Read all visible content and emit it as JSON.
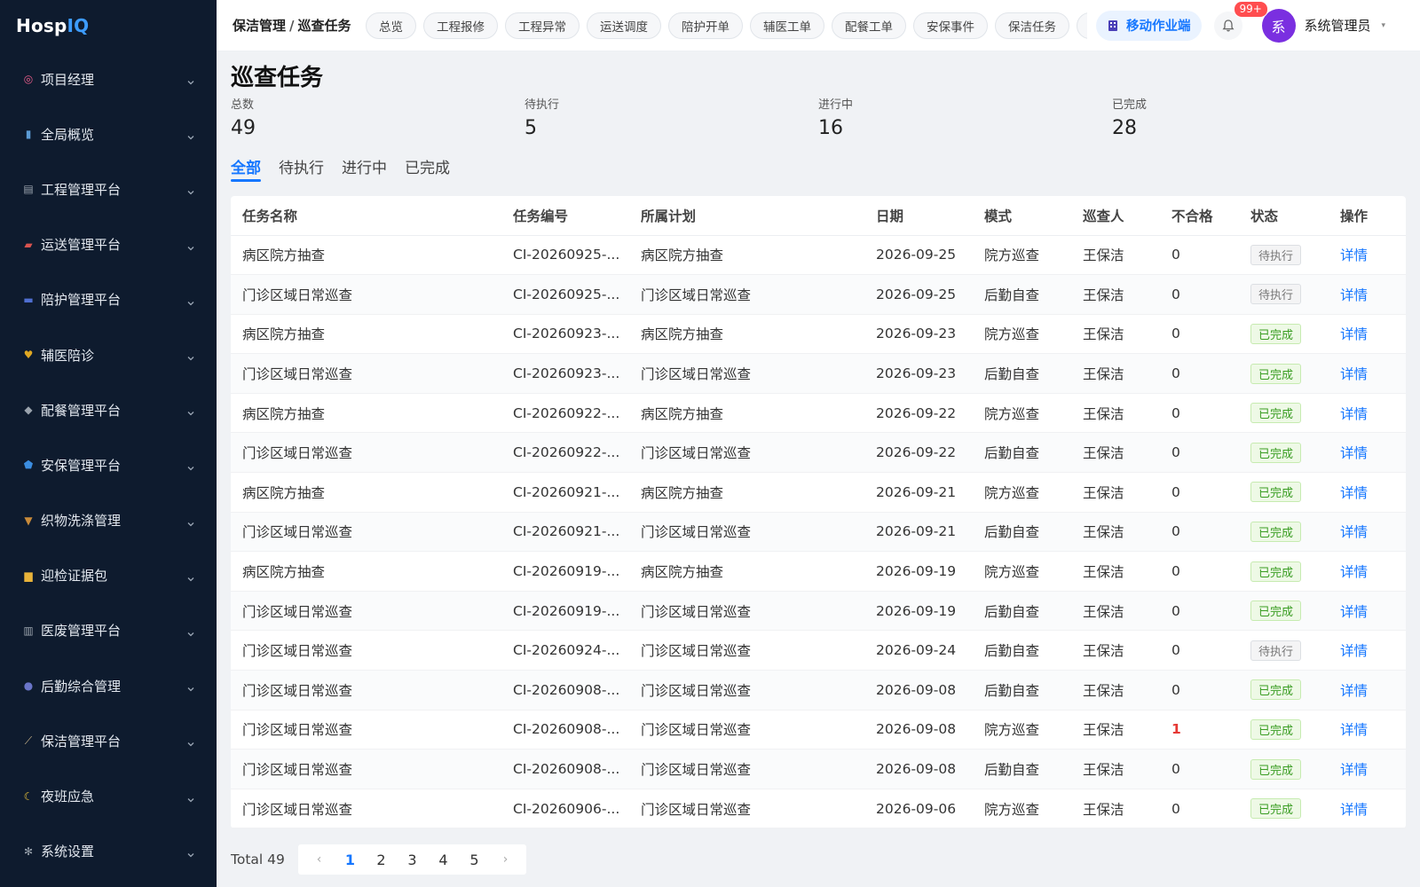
{
  "app": {
    "logo_main": "Hosp",
    "logo_accent": "IQ"
  },
  "sidebar": {
    "items": [
      {
        "label": "项目经理",
        "icon": "target-icon",
        "color": "#e85d8a"
      },
      {
        "label": "全局概览",
        "icon": "chart-icon",
        "color": "#5b9bd5"
      },
      {
        "label": "工程管理平台",
        "icon": "building-icon",
        "color": "#9aa3ad"
      },
      {
        "label": "运送管理平台",
        "icon": "truck-icon",
        "color": "#d9534f"
      },
      {
        "label": "陪护管理平台",
        "icon": "bed-icon",
        "color": "#4f6fd1"
      },
      {
        "label": "辅医陪诊",
        "icon": "heart-icon",
        "color": "#e0a823"
      },
      {
        "label": "配餐管理平台",
        "icon": "food-icon",
        "color": "#9aa3ad"
      },
      {
        "label": "安保管理平台",
        "icon": "shield-icon",
        "color": "#3b8de0"
      },
      {
        "label": "织物洗涤管理",
        "icon": "basket-icon",
        "color": "#c98b3a"
      },
      {
        "label": "迎检证据包",
        "icon": "folder-icon",
        "color": "#e8b33a"
      },
      {
        "label": "医废管理平台",
        "icon": "trash-icon",
        "color": "#9aa3ad"
      },
      {
        "label": "后勤综合管理",
        "icon": "people-icon",
        "color": "#6a75c9"
      },
      {
        "label": "保洁管理平台",
        "icon": "broom-icon",
        "color": "#c9b48a"
      },
      {
        "label": "夜班应急",
        "icon": "moon-icon",
        "color": "#e8c23a"
      },
      {
        "label": "系统设置",
        "icon": "gear-icon",
        "color": "#9aa3ad"
      }
    ]
  },
  "topbar": {
    "breadcrumb_parent": "保洁管理",
    "breadcrumb_sep": "/",
    "breadcrumb_current": "巡查任务",
    "tabs": [
      "总览",
      "工程报修",
      "工程异常",
      "运送调度",
      "陪护开单",
      "辅医工单",
      "配餐工单",
      "安保事件",
      "保洁任务",
      "医"
    ],
    "mobile_label": "移动作业端",
    "notif_badge": "99+",
    "avatar_text": "系",
    "user_name": "系统管理员"
  },
  "page": {
    "title": "巡查任务",
    "stats": [
      {
        "label": "总数",
        "value": "49"
      },
      {
        "label": "待执行",
        "value": "5"
      },
      {
        "label": "进行中",
        "value": "16"
      },
      {
        "label": "已完成",
        "value": "28"
      }
    ],
    "filters": [
      "全部",
      "待执行",
      "进行中",
      "已完成"
    ],
    "active_filter": "全部"
  },
  "table": {
    "columns": [
      "任务名称",
      "任务编号",
      "所属计划",
      "日期",
      "模式",
      "巡查人",
      "不合格",
      "状态",
      "操作"
    ],
    "rows": [
      {
        "name": "病区院方抽查",
        "code": "CI-20260925-...",
        "plan": "病区院方抽查",
        "date": "2026-09-25",
        "mode": "院方巡查",
        "inspector": "王保洁",
        "fail": "0",
        "status": "待执行",
        "action": "详情"
      },
      {
        "name": "门诊区域日常巡查",
        "code": "CI-20260925-...",
        "plan": "门诊区域日常巡查",
        "date": "2026-09-25",
        "mode": "后勤自查",
        "inspector": "王保洁",
        "fail": "0",
        "status": "待执行",
        "action": "详情"
      },
      {
        "name": "病区院方抽查",
        "code": "CI-20260923-...",
        "plan": "病区院方抽查",
        "date": "2026-09-23",
        "mode": "院方巡查",
        "inspector": "王保洁",
        "fail": "0",
        "status": "已完成",
        "action": "详情"
      },
      {
        "name": "门诊区域日常巡查",
        "code": "CI-20260923-...",
        "plan": "门诊区域日常巡查",
        "date": "2026-09-23",
        "mode": "后勤自查",
        "inspector": "王保洁",
        "fail": "0",
        "status": "已完成",
        "action": "详情"
      },
      {
        "name": "病区院方抽查",
        "code": "CI-20260922-...",
        "plan": "病区院方抽查",
        "date": "2026-09-22",
        "mode": "院方巡查",
        "inspector": "王保洁",
        "fail": "0",
        "status": "已完成",
        "action": "详情"
      },
      {
        "name": "门诊区域日常巡查",
        "code": "CI-20260922-...",
        "plan": "门诊区域日常巡查",
        "date": "2026-09-22",
        "mode": "后勤自查",
        "inspector": "王保洁",
        "fail": "0",
        "status": "已完成",
        "action": "详情"
      },
      {
        "name": "病区院方抽查",
        "code": "CI-20260921-...",
        "plan": "病区院方抽查",
        "date": "2026-09-21",
        "mode": "院方巡查",
        "inspector": "王保洁",
        "fail": "0",
        "status": "已完成",
        "action": "详情"
      },
      {
        "name": "门诊区域日常巡查",
        "code": "CI-20260921-...",
        "plan": "门诊区域日常巡查",
        "date": "2026-09-21",
        "mode": "后勤自查",
        "inspector": "王保洁",
        "fail": "0",
        "status": "已完成",
        "action": "详情"
      },
      {
        "name": "病区院方抽查",
        "code": "CI-20260919-...",
        "plan": "病区院方抽查",
        "date": "2026-09-19",
        "mode": "院方巡查",
        "inspector": "王保洁",
        "fail": "0",
        "status": "已完成",
        "action": "详情"
      },
      {
        "name": "门诊区域日常巡查",
        "code": "CI-20260919-...",
        "plan": "门诊区域日常巡查",
        "date": "2026-09-19",
        "mode": "后勤自查",
        "inspector": "王保洁",
        "fail": "0",
        "status": "已完成",
        "action": "详情"
      },
      {
        "name": "门诊区域日常巡查",
        "code": "CI-20260924-...",
        "plan": "门诊区域日常巡查",
        "date": "2026-09-24",
        "mode": "后勤自查",
        "inspector": "王保洁",
        "fail": "0",
        "status": "待执行",
        "action": "详情"
      },
      {
        "name": "门诊区域日常巡查",
        "code": "CI-20260908-...",
        "plan": "门诊区域日常巡查",
        "date": "2026-09-08",
        "mode": "后勤自查",
        "inspector": "王保洁",
        "fail": "0",
        "status": "已完成",
        "action": "详情"
      },
      {
        "name": "门诊区域日常巡查",
        "code": "CI-20260908-...",
        "plan": "门诊区域日常巡查",
        "date": "2026-09-08",
        "mode": "院方巡查",
        "inspector": "王保洁",
        "fail": "1",
        "status": "已完成",
        "action": "详情"
      },
      {
        "name": "门诊区域日常巡查",
        "code": "CI-20260908-...",
        "plan": "门诊区域日常巡查",
        "date": "2026-09-08",
        "mode": "后勤自查",
        "inspector": "王保洁",
        "fail": "0",
        "status": "已完成",
        "action": "详情"
      },
      {
        "name": "门诊区域日常巡查",
        "code": "CI-20260906-...",
        "plan": "门诊区域日常巡查",
        "date": "2026-09-06",
        "mode": "院方巡查",
        "inspector": "王保洁",
        "fail": "0",
        "status": "已完成",
        "action": "详情"
      }
    ]
  },
  "pagination": {
    "total_label": "Total 49",
    "pages": [
      "1",
      "2",
      "3",
      "4",
      "5"
    ],
    "current": "1",
    "prev": "‹",
    "next": "›"
  },
  "colors": {
    "sidebar_bg": "#0e1b2e",
    "accent": "#1677ff",
    "done_green": "#3a9d23",
    "fail_red": "#e53935",
    "avatar_purple": "#7a2fe0"
  }
}
